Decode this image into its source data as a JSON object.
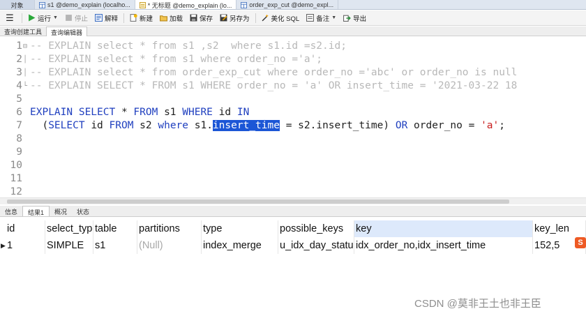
{
  "tabs": [
    {
      "label": "对象",
      "icon": "objects-icon"
    },
    {
      "label": "s1 @demo_explain (localho...",
      "icon": "table-icon"
    },
    {
      "label": "* 无标题 @demo_explain (lo...",
      "icon": "query-icon"
    },
    {
      "label": "order_exp_cut @demo_expl...",
      "icon": "table-icon"
    }
  ],
  "toolbar": {
    "run": "运行",
    "stop": "停止",
    "explain": "解释",
    "new": "新建",
    "load": "加载",
    "save": "保存",
    "save_as": "另存为",
    "beautify": "美化 SQL",
    "comment": "备注",
    "export": "导出"
  },
  "subtabs": [
    "查询创建工具",
    "查询编辑器"
  ],
  "editor": {
    "lines": [
      {
        "n": "1",
        "fold": "⊟",
        "parts": [
          {
            "c": "cm",
            "t": "-- EXPLAIN select * from s1 ,s2  where s1.id =s2.id;"
          }
        ]
      },
      {
        "n": "2",
        "fold": "│",
        "parts": [
          {
            "c": "cm",
            "t": "-- EXPLAIN select * from s1 where order_no ='a';"
          }
        ]
      },
      {
        "n": "3",
        "fold": "│",
        "parts": [
          {
            "c": "cm",
            "t": "-- EXPLAIN select * from order_exp_cut where order_no ='abc' or order_no is null"
          }
        ]
      },
      {
        "n": "4",
        "fold": "└",
        "parts": [
          {
            "c": "cm",
            "t": "-- EXPLAIN SELECT * FROM s1 WHERE order_no = 'a' OR insert_time = '2021-03-22 18"
          }
        ]
      },
      {
        "n": "5",
        "fold": "",
        "parts": []
      },
      {
        "n": "6",
        "fold": "",
        "parts": [
          {
            "c": "kw",
            "t": "EXPLAIN SELECT"
          },
          {
            "c": "tx",
            "t": " * "
          },
          {
            "c": "kw",
            "t": "FROM"
          },
          {
            "c": "tx",
            "t": " s1 "
          },
          {
            "c": "kw",
            "t": "WHERE"
          },
          {
            "c": "tx",
            "t": " id "
          },
          {
            "c": "kw",
            "t": "IN"
          }
        ]
      },
      {
        "n": "7",
        "fold": "",
        "parts": [
          {
            "c": "tx",
            "t": "  ("
          },
          {
            "c": "kw",
            "t": "SELECT"
          },
          {
            "c": "tx",
            "t": " id "
          },
          {
            "c": "kw",
            "t": "FROM"
          },
          {
            "c": "tx",
            "t": " s2 "
          },
          {
            "c": "kw",
            "t": "where"
          },
          {
            "c": "tx",
            "t": " s1."
          },
          {
            "c": "sel",
            "t": "insert_time"
          },
          {
            "c": "tx",
            "t": " = s2.insert_time) "
          },
          {
            "c": "kw",
            "t": "OR"
          },
          {
            "c": "tx",
            "t": " order_no = "
          },
          {
            "c": "st",
            "t": "'a'"
          },
          {
            "c": "tx",
            "t": ";"
          }
        ]
      },
      {
        "n": "8",
        "fold": "",
        "parts": []
      },
      {
        "n": "9",
        "fold": "",
        "parts": []
      },
      {
        "n": "10",
        "fold": "",
        "parts": []
      },
      {
        "n": "11",
        "fold": "",
        "parts": []
      },
      {
        "n": "12",
        "fold": "",
        "parts": []
      }
    ]
  },
  "result_tabs": [
    "信息",
    "结果1",
    "概况",
    "状态"
  ],
  "grid": {
    "columns": [
      "id",
      "select_type",
      "table",
      "partitions",
      "type",
      "possible_keys",
      "key",
      "key_len"
    ],
    "rows": [
      [
        "1",
        "SIMPLE",
        "s1",
        "(Null)",
        "index_merge",
        "u_idx_day_status",
        "idx_order_no,idx_insert_time",
        "152,5"
      ]
    ]
  },
  "ime_label": "英",
  "watermark": "CSDN @莫非王土也非王臣",
  "colors": {
    "keyword": "#1f3fbf",
    "comment": "#b8b8b8",
    "string": "#c81e1e",
    "selection": "#1c56d6",
    "sorted_header": "#dde9fb"
  }
}
